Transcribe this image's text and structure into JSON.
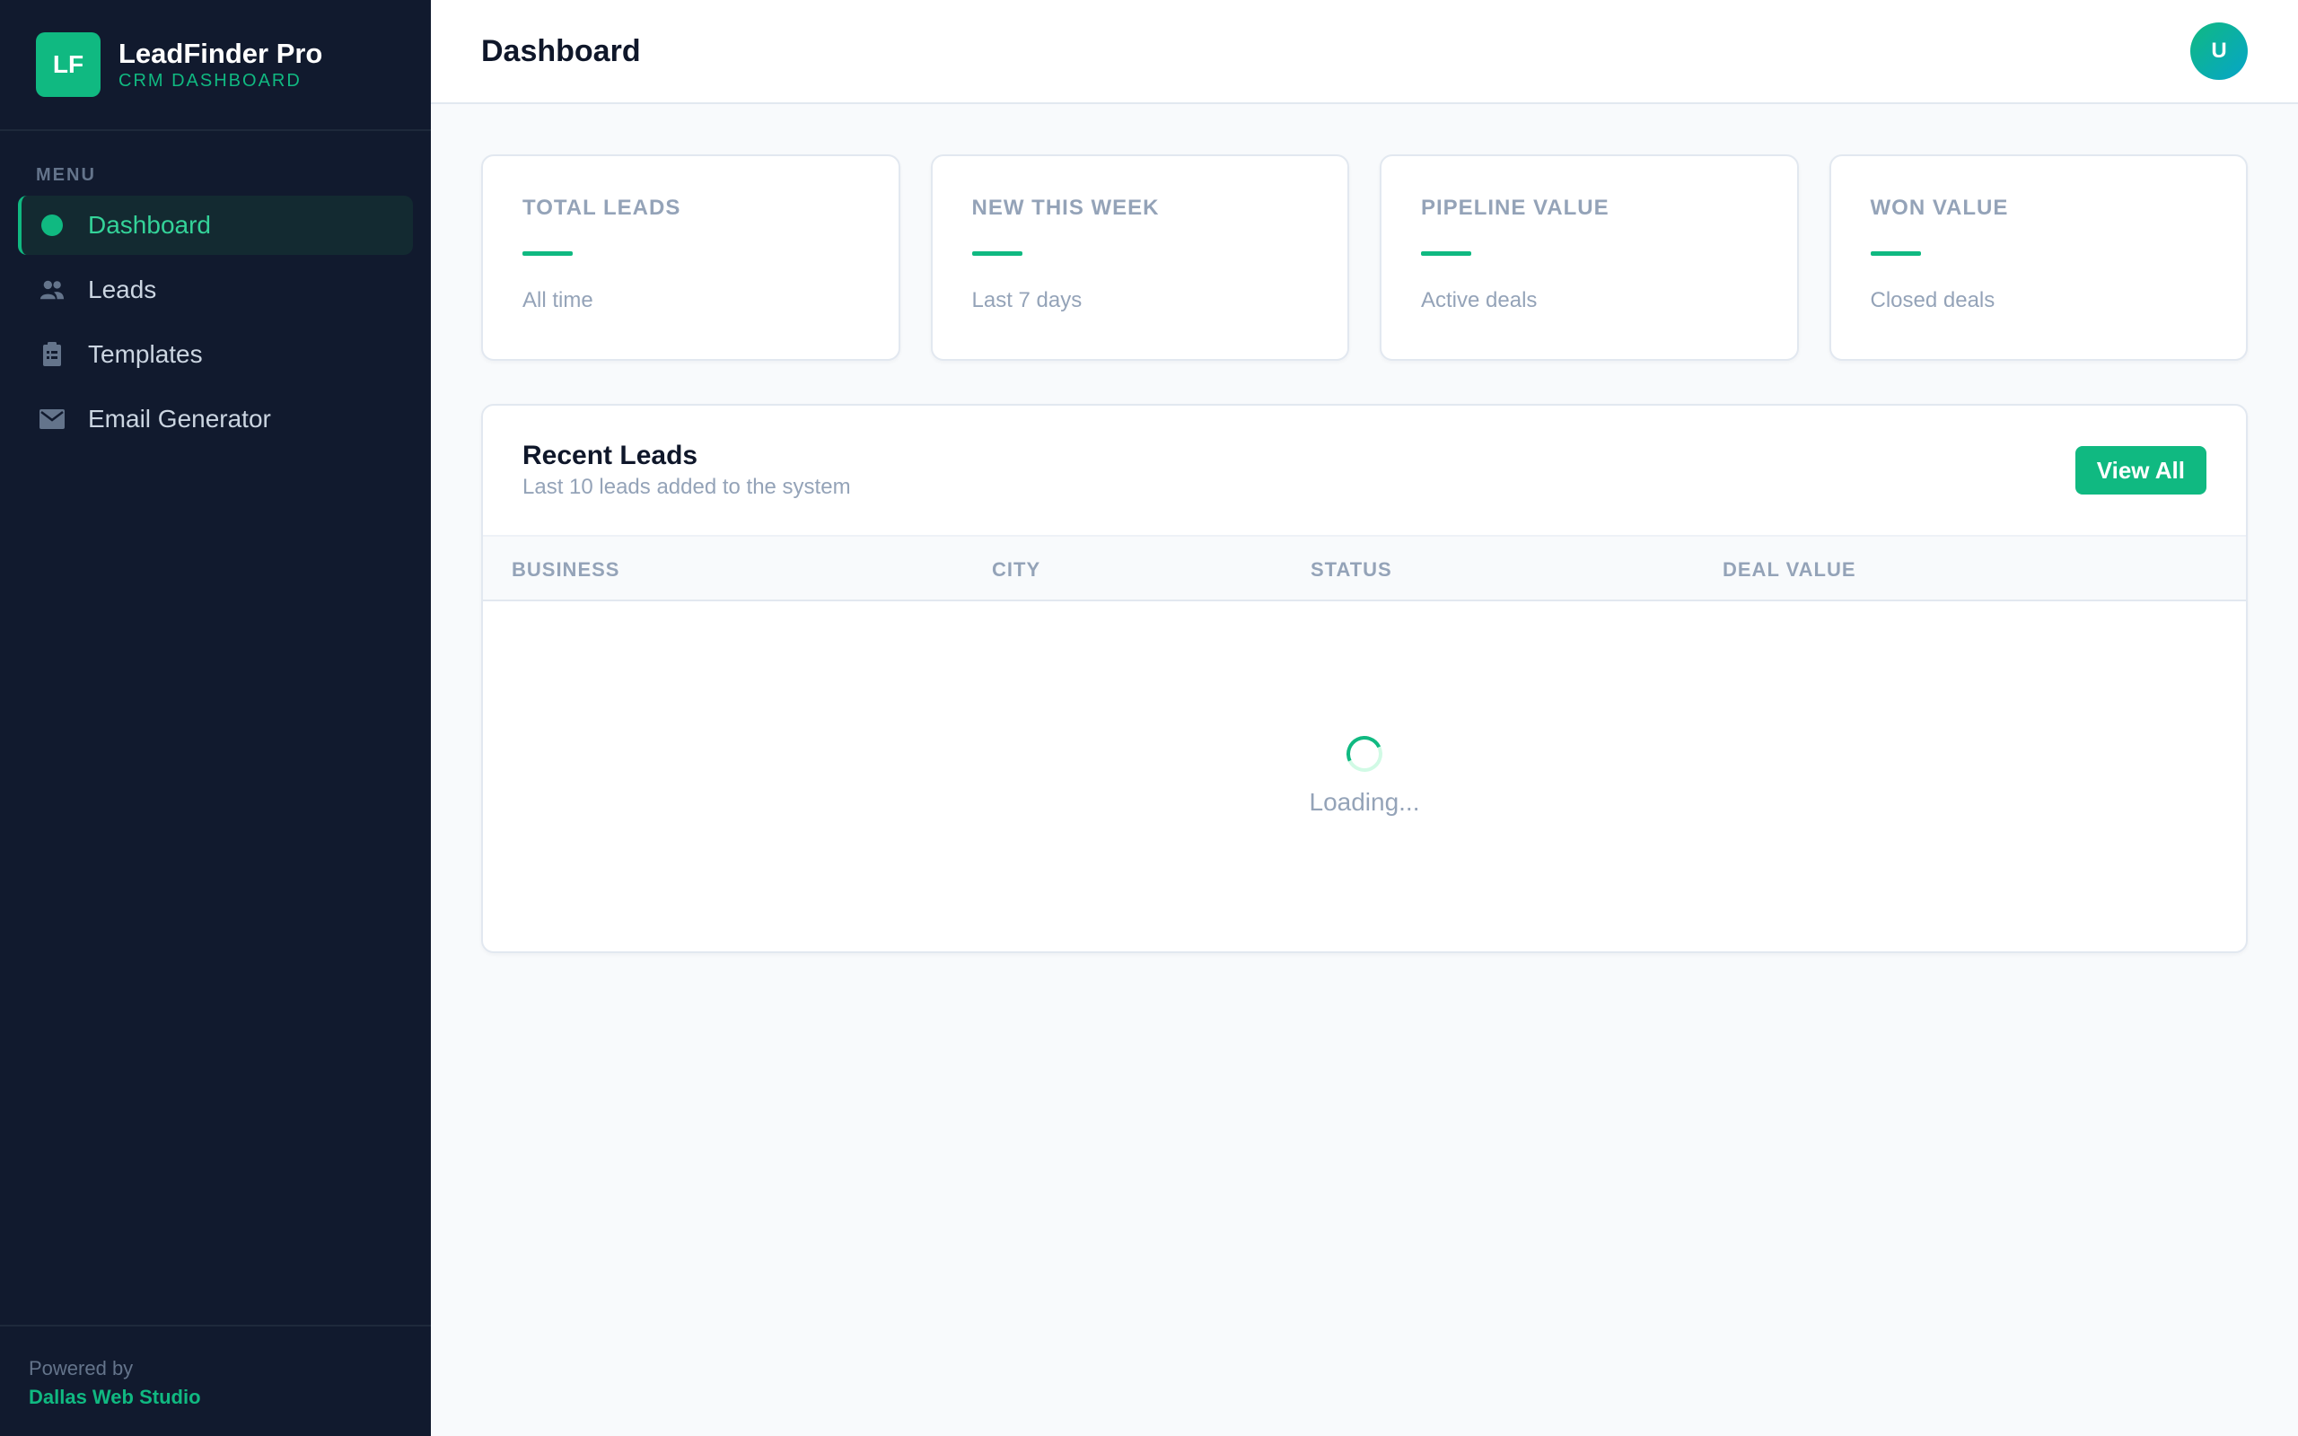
{
  "brand": {
    "logo": "LF",
    "name": "LeadFinder Pro",
    "subtitle": "CRM DASHBOARD"
  },
  "sidebar": {
    "menu_label": "MENU",
    "items": [
      {
        "label": "Dashboard",
        "icon": "dot-icon",
        "active": true
      },
      {
        "label": "Leads",
        "icon": "users-icon",
        "active": false
      },
      {
        "label": "Templates",
        "icon": "clipboard-icon",
        "active": false
      },
      {
        "label": "Email Generator",
        "icon": "envelope-icon",
        "active": false
      }
    ],
    "footer": {
      "powered_by": "Powered by",
      "studio": "Dallas Web Studio"
    }
  },
  "header": {
    "title": "Dashboard",
    "avatar_initial": "U"
  },
  "stats": [
    {
      "label": "TOTAL LEADS",
      "sub": "All time"
    },
    {
      "label": "NEW THIS WEEK",
      "sub": "Last 7 days"
    },
    {
      "label": "PIPELINE VALUE",
      "sub": "Active deals"
    },
    {
      "label": "WON VALUE",
      "sub": "Closed deals"
    }
  ],
  "recent_leads": {
    "title": "Recent Leads",
    "subtitle": "Last 10 leads added to the system",
    "view_all_label": "View All",
    "columns": [
      "BUSINESS",
      "CITY",
      "STATUS",
      "DEAL VALUE"
    ],
    "loading_text": "Loading..."
  },
  "colors": {
    "accent": "#10b981",
    "sidebar_bg": "#111a2e",
    "page_bg": "#f8fafc"
  }
}
